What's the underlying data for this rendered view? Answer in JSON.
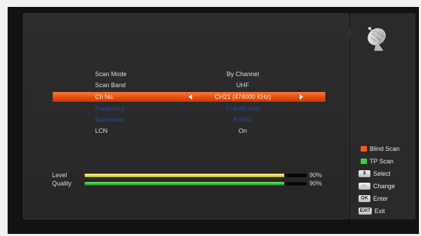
{
  "colors": {
    "highlight": "#e24a10",
    "panel": "#2d2d2d",
    "level_bar": "#e7d73a",
    "quality_bar": "#2eb02e",
    "blind_scan_key": "#ff5a1e",
    "tp_scan_key": "#3cd23c"
  },
  "icons": {
    "header": "satellite-dish-icon"
  },
  "scan_settings": [
    {
      "label": "Scan Mode",
      "value": "By Channel"
    },
    {
      "label": "Scan Band",
      "value": "UHF"
    },
    {
      "label": "Ch No.",
      "value": "CH21 (474000 KHz)",
      "selected": true
    },
    {
      "label": "Frequency",
      "value": "474000 KHz",
      "disabled": true
    },
    {
      "label": "Bandwidth",
      "value": "8 MHz",
      "disabled": true
    },
    {
      "label": "LCN",
      "value": "On"
    }
  ],
  "signal": {
    "level": {
      "label": "Level",
      "percent": 90,
      "percent_text": "90%"
    },
    "quality": {
      "label": "Quality",
      "percent": 90,
      "percent_text": "90%"
    }
  },
  "legend": [
    {
      "key": "red-color-key",
      "label": "Blind Scan"
    },
    {
      "key": "green-color-key",
      "label": "TP Scan"
    },
    {
      "key": "up-down-keys",
      "label": "Select"
    },
    {
      "key": "left-right-keys",
      "label": "Change"
    },
    {
      "key": "ok-key",
      "key_text": "OK",
      "label": "Enter"
    },
    {
      "key": "exit-key",
      "key_text": "EXIT",
      "label": "Exit"
    }
  ]
}
